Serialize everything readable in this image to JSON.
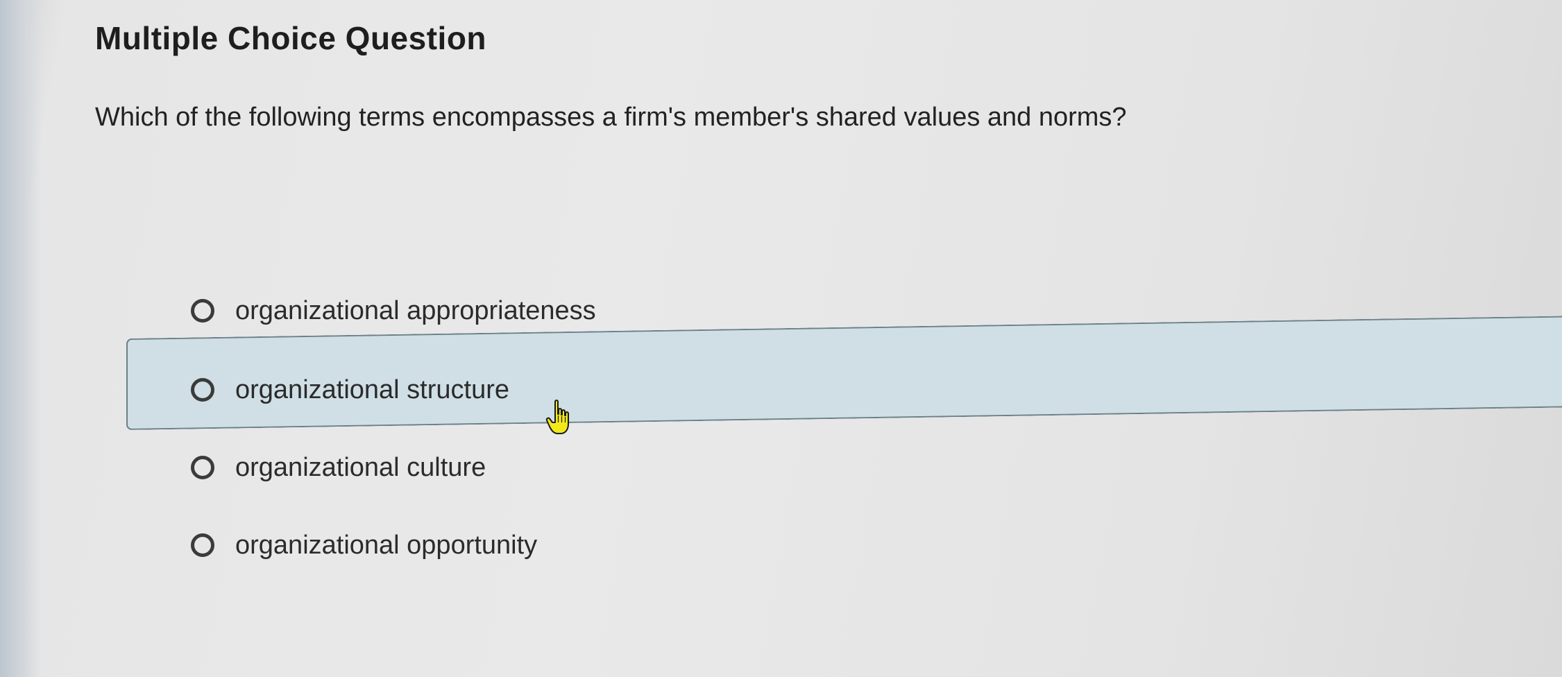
{
  "question_card": {
    "title": "Multiple Choice Question",
    "prompt": "Which of the following terms encompasses a firm's member's shared values and norms?",
    "options": [
      {
        "label": "organizational appropriateness",
        "selected": false,
        "hovered": false
      },
      {
        "label": "organizational structure",
        "selected": false,
        "hovered": true
      },
      {
        "label": "organizational culture",
        "selected": false,
        "hovered": false
      },
      {
        "label": "organizational opportunity",
        "selected": false,
        "hovered": false
      }
    ]
  },
  "colors": {
    "hover_background": "#cfdfe5",
    "hover_border": "#6b7f88",
    "radio_ring": "#3b3b3b",
    "cursor_fill": "#f2e81c"
  },
  "icons": {
    "cursor": "hand-pointer-icon",
    "radio": "radio-unchecked-icon"
  }
}
